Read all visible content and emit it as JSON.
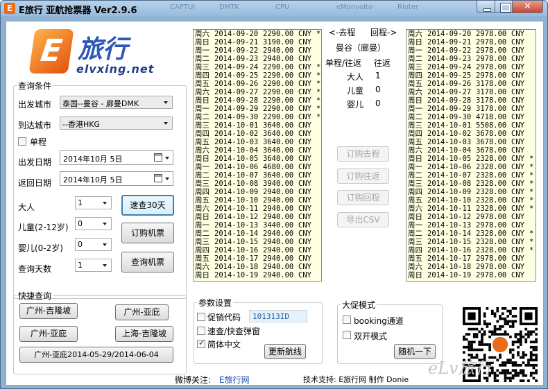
{
  "window": {
    "title": "E旅行 亚航抢票器 Ver2.9.6",
    "ghost_tabs": [
      "CAPTUI",
      "DMTK",
      "CPU",
      "eMonvolto",
      "Rioter"
    ],
    "close_glyph": "✕"
  },
  "logo": {
    "cn": "旅行",
    "en": "elvxing.net",
    "mark": "E"
  },
  "query_conditions": {
    "legend": "查询条件",
    "from_label": "出发城市",
    "from_value": "泰国--曼谷 - 廊曼DMK",
    "to_label": "到达城市",
    "to_value": "--香港HKG",
    "oneway_label": "单程",
    "depart_label": "出发日期",
    "depart_value": "2014年10月 5日",
    "return_label": "返回日期",
    "return_value": "2014年10月 5日",
    "adult_label": "大人",
    "adult_value": "1",
    "child_label": "儿童(2-12岁)",
    "child_value": "0",
    "infant_label": "婴儿(0-2岁)",
    "infant_value": "0",
    "days_label": "查询天数",
    "days_value": "1",
    "btn_quick30": "速查30天",
    "btn_book": "订购机票",
    "btn_query": "查询机票"
  },
  "quick_query": {
    "legend": "快捷查询",
    "buttons": [
      "广州-吉隆坡",
      "广州-亚庇",
      "广州-亚庇",
      "上海-吉隆坡",
      "广州-亚庇2014-05-29/2014-06-04"
    ]
  },
  "outbound_list": [
    [
      "周六",
      "2014-09-20",
      "2290.00",
      "CNY",
      "*"
    ],
    [
      "周日",
      "2014-09-21",
      "3190.00",
      "CNY",
      ""
    ],
    [
      "周一",
      "2014-09-22",
      "2940.00",
      "CNY",
      ""
    ],
    [
      "周二",
      "2014-09-23",
      "2940.00",
      "CNY",
      ""
    ],
    [
      "周三",
      "2014-09-24",
      "2290.00",
      "CNY",
      "*"
    ],
    [
      "周四",
      "2014-09-25",
      "2290.00",
      "CNY",
      "*"
    ],
    [
      "周五",
      "2014-09-26",
      "2290.00",
      "CNY",
      "*"
    ],
    [
      "周六",
      "2014-09-27",
      "2290.00",
      "CNY",
      "*"
    ],
    [
      "周日",
      "2014-09-28",
      "2290.00",
      "CNY",
      "*"
    ],
    [
      "周一",
      "2014-09-29",
      "2290.00",
      "CNY",
      "*"
    ],
    [
      "周二",
      "2014-09-30",
      "2290.00",
      "CNY",
      "*"
    ],
    [
      "周三",
      "2014-10-01",
      "3640.00",
      "CNY",
      ""
    ],
    [
      "周四",
      "2014-10-02",
      "3640.00",
      "CNY",
      ""
    ],
    [
      "周五",
      "2014-10-03",
      "3640.00",
      "CNY",
      ""
    ],
    [
      "周六",
      "2014-10-04",
      "3640.00",
      "CNY",
      ""
    ],
    [
      "周日",
      "2014-10-05",
      "3640.00",
      "CNY",
      ""
    ],
    [
      "周一",
      "2014-10-06",
      "4680.00",
      "CNY",
      ""
    ],
    [
      "周二",
      "2014-10-07",
      "3640.00",
      "CNY",
      ""
    ],
    [
      "周三",
      "2014-10-08",
      "3940.00",
      "CNY",
      ""
    ],
    [
      "周四",
      "2014-10-09",
      "2940.00",
      "CNY",
      ""
    ],
    [
      "周五",
      "2014-10-10",
      "2940.00",
      "CNY",
      ""
    ],
    [
      "周六",
      "2014-10-11",
      "2940.00",
      "CNY",
      ""
    ],
    [
      "周日",
      "2014-10-12",
      "2940.00",
      "CNY",
      ""
    ],
    [
      "周一",
      "2014-10-13",
      "3440.00",
      "CNY",
      ""
    ],
    [
      "周二",
      "2014-10-14",
      "2940.00",
      "CNY",
      ""
    ],
    [
      "周三",
      "2014-10-15",
      "2940.00",
      "CNY",
      ""
    ],
    [
      "周四",
      "2014-10-16",
      "2940.00",
      "CNY",
      ""
    ],
    [
      "周五",
      "2014-10-17",
      "2940.00",
      "CNY",
      ""
    ],
    [
      "周六",
      "2014-10-18",
      "2940.00",
      "CNY",
      ""
    ],
    [
      "周日",
      "2014-10-19",
      "2940.00",
      "CNY",
      ""
    ]
  ],
  "return_list": [
    [
      "周六",
      "2014-09-20",
      "2978.00",
      "CNY",
      ""
    ],
    [
      "周日",
      "2014-09-21",
      "2978.00",
      "CNY",
      ""
    ],
    [
      "周一",
      "2014-09-22",
      "2978.00",
      "CNY",
      ""
    ],
    [
      "周二",
      "2014-09-23",
      "2978.00",
      "CNY",
      ""
    ],
    [
      "周三",
      "2014-09-24",
      "2978.00",
      "CNY",
      ""
    ],
    [
      "周四",
      "2014-09-25",
      "2978.00",
      "CNY",
      ""
    ],
    [
      "周五",
      "2014-09-26",
      "3178.00",
      "CNY",
      ""
    ],
    [
      "周六",
      "2014-09-27",
      "3178.00",
      "CNY",
      ""
    ],
    [
      "周日",
      "2014-09-28",
      "3178.00",
      "CNY",
      ""
    ],
    [
      "周一",
      "2014-09-29",
      "3178.00",
      "CNY",
      ""
    ],
    [
      "周二",
      "2014-09-30",
      "4718.00",
      "CNY",
      ""
    ],
    [
      "周三",
      "2014-10-01",
      "5508.00",
      "CNY",
      ""
    ],
    [
      "周四",
      "2014-10-02",
      "3678.00",
      "CNY",
      ""
    ],
    [
      "周五",
      "2014-10-03",
      "3678.00",
      "CNY",
      ""
    ],
    [
      "周六",
      "2014-10-04",
      "3678.00",
      "CNY",
      ""
    ],
    [
      "周日",
      "2014-10-05",
      "2328.00",
      "CNY",
      "*"
    ],
    [
      "周一",
      "2014-10-06",
      "2328.00",
      "CNY",
      "*"
    ],
    [
      "周二",
      "2014-10-07",
      "2328.00",
      "CNY",
      "*"
    ],
    [
      "周三",
      "2014-10-08",
      "2328.00",
      "CNY",
      "*"
    ],
    [
      "周四",
      "2014-10-09",
      "2328.00",
      "CNY",
      "*"
    ],
    [
      "周五",
      "2014-10-10",
      "2328.00",
      "CNY",
      "*"
    ],
    [
      "周六",
      "2014-10-11",
      "2328.00",
      "CNY",
      "*"
    ],
    [
      "周日",
      "2014-10-12",
      "2978.00",
      "CNY",
      ""
    ],
    [
      "周一",
      "2014-10-13",
      "2978.00",
      "CNY",
      ""
    ],
    [
      "周二",
      "2014-10-14",
      "2328.00",
      "CNY",
      "*"
    ],
    [
      "周三",
      "2014-10-15",
      "2328.00",
      "CNY",
      "*"
    ],
    [
      "周四",
      "2014-10-16",
      "2328.00",
      "CNY",
      "*"
    ],
    [
      "周五",
      "2014-10-17",
      "2978.00",
      "CNY",
      ""
    ],
    [
      "周六",
      "2014-10-18",
      "2978.00",
      "CNY",
      ""
    ],
    [
      "周日",
      "2014-10-19",
      "2978.00",
      "CNY",
      ""
    ]
  ],
  "center": {
    "dir_go": "<-去程",
    "dir_return": "回程->",
    "city": "曼谷（廊曼）",
    "trip_label": "单程/往返",
    "trip_value": "往返",
    "adult_label": "大人",
    "adult_value": "1",
    "child_label": "儿童",
    "child_value": "0",
    "infant_label": "婴儿",
    "infant_value": "0",
    "btn_book_go": "订购去程",
    "btn_book_round": "订购往返",
    "btn_book_return": "订购回程",
    "btn_export": "导出CSV"
  },
  "params": {
    "legend": "参数设置",
    "promo_label": "促销代码",
    "promo_value": "101313ID",
    "popup_label": "速查/快查弹窗",
    "simplified_label": "简体中文",
    "btn_update_routes": "更新航线"
  },
  "promo_mode": {
    "legend": "大促模式",
    "booking_label": "booking通道",
    "dual_label": "双开模式",
    "btn_random": "随机一下"
  },
  "footer": {
    "weibo_label": "微博关注:",
    "weibo_link": "E旅行网",
    "support": "技术支持: E旅行网 制作 Donie"
  },
  "watermark": "eLv旅行",
  "colors": {
    "list_bg": "#ffffe1",
    "accent_blue": "#3c7fb1",
    "brand_orange": "#e86c1a"
  }
}
